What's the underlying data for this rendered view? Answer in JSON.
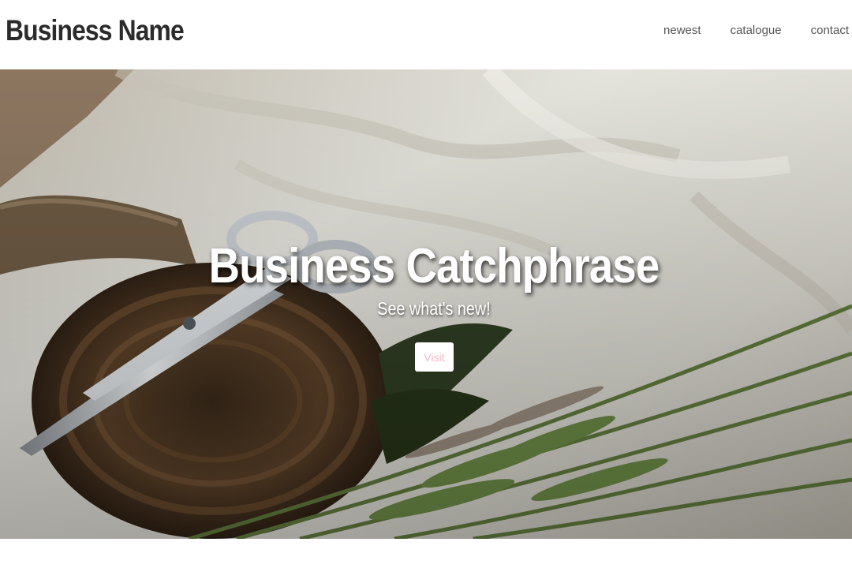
{
  "header": {
    "brand": "Business Name",
    "nav": [
      "newest",
      "catalogue",
      "contact"
    ]
  },
  "hero": {
    "catchphrase": "Business Catchphrase",
    "subtitle": "See what's new!",
    "button_label": "Visit",
    "image_subject": "scissors, twine spool, evergreen sprig and wheat stalks on crumpled linen"
  },
  "colors": {
    "brand_text": "#2b2b2b",
    "nav_text": "#555555",
    "button_text": "#f3b8c4",
    "background": "#ffffff"
  }
}
